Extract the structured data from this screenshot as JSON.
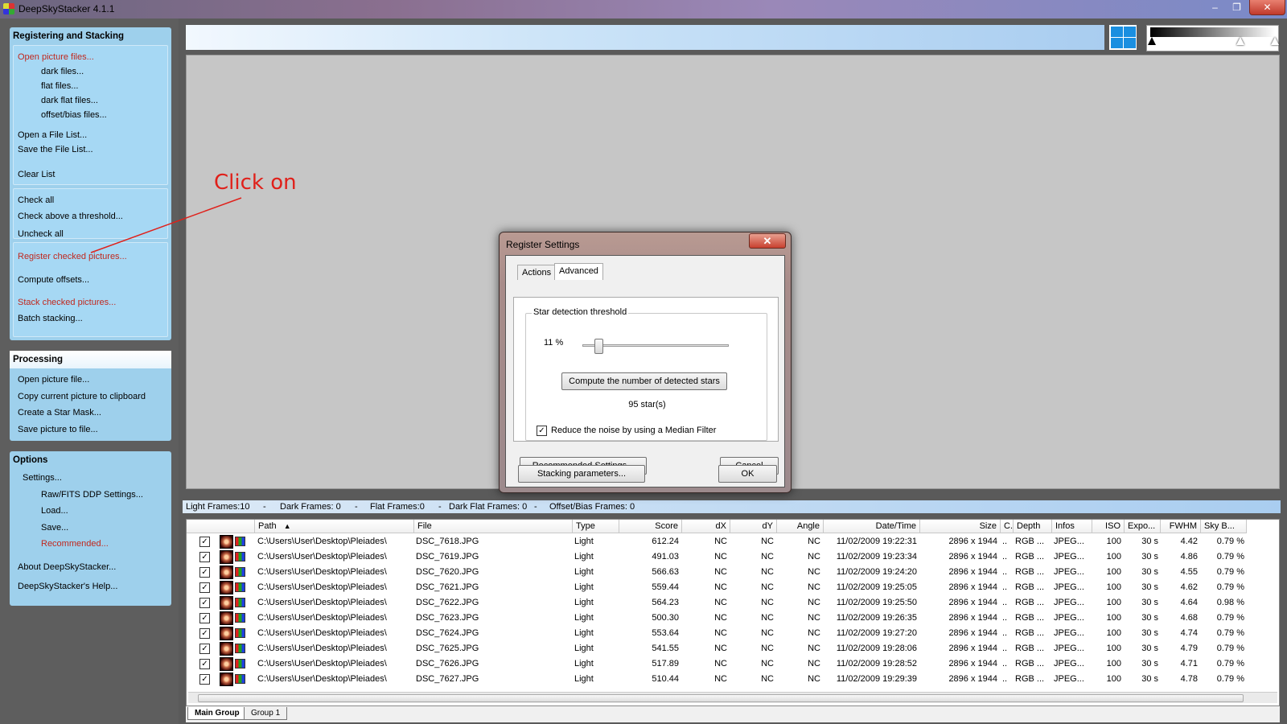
{
  "window": {
    "title": "DeepSkyStacker 4.1.1",
    "minimize": "–",
    "restore": "❐",
    "close": "✕"
  },
  "sidebar": {
    "registering": {
      "title": "Registering and Stacking",
      "open_picture_files": "Open picture files...",
      "dark_files": "dark files...",
      "flat_files": "flat files...",
      "dark_flat_files": "dark flat files...",
      "offset_bias_files": "offset/bias files...",
      "open_file_list": "Open a File List...",
      "save_file_list": "Save the File List...",
      "clear_list": "Clear List",
      "check_all": "Check all",
      "check_above": "Check above a threshold...",
      "uncheck_all": "Uncheck all",
      "register_checked": "Register checked pictures...",
      "compute_offsets": "Compute offsets...",
      "stack_checked": "Stack checked pictures...",
      "batch_stacking": "Batch stacking..."
    },
    "processing": {
      "title": "Processing",
      "open_picture_file": "Open picture file...",
      "copy_clipboard": "Copy current picture to clipboard",
      "create_star_mask": "Create a Star Mask...",
      "save_picture": "Save picture to file..."
    },
    "options": {
      "title": "Options",
      "settings": "Settings...",
      "raw_fits": "Raw/FITS DDP Settings...",
      "load": "Load...",
      "save": "Save...",
      "recommended": "Recommended...",
      "about": "About DeepSkyStacker...",
      "help": "DeepSkyStacker's Help..."
    }
  },
  "annotation": {
    "text": "Click on"
  },
  "frames": {
    "light": "Light Frames:10",
    "sep1": "-",
    "dark": "Dark Frames: 0",
    "sep2": "-",
    "flat": "Flat Frames:0",
    "sep3": "-",
    "dark_flat": "Dark Flat Frames: 0",
    "sep4": "-",
    "offset": "Offset/Bias Frames: 0"
  },
  "table": {
    "columns": [
      "Path",
      "File",
      "Type",
      "Score",
      "dX",
      "dY",
      "Angle",
      "Date/Time",
      "Size",
      "C.",
      "Depth",
      "Infos",
      "ISO",
      "Expo...",
      "FWHM",
      "Sky B..."
    ],
    "sort_indicator": "▲",
    "rows": [
      [
        "C:\\Users\\User\\Desktop\\Pleiades\\",
        "DSC_7618.JPG",
        "Light",
        "612.24",
        "NC",
        "NC",
        "NC",
        "11/02/2009 19:22:31",
        "2896 x 1944",
        "..",
        "RGB ...",
        "JPEG...",
        "100",
        "30 s",
        "4.42",
        "0.79 %"
      ],
      [
        "C:\\Users\\User\\Desktop\\Pleiades\\",
        "DSC_7619.JPG",
        "Light",
        "491.03",
        "NC",
        "NC",
        "NC",
        "11/02/2009 19:23:34",
        "2896 x 1944",
        "..",
        "RGB ...",
        "JPEG...",
        "100",
        "30 s",
        "4.86",
        "0.79 %"
      ],
      [
        "C:\\Users\\User\\Desktop\\Pleiades\\",
        "DSC_7620.JPG",
        "Light",
        "566.63",
        "NC",
        "NC",
        "NC",
        "11/02/2009 19:24:20",
        "2896 x 1944",
        "..",
        "RGB ...",
        "JPEG...",
        "100",
        "30 s",
        "4.55",
        "0.79 %"
      ],
      [
        "C:\\Users\\User\\Desktop\\Pleiades\\",
        "DSC_7621.JPG",
        "Light",
        "559.44",
        "NC",
        "NC",
        "NC",
        "11/02/2009 19:25:05",
        "2896 x 1944",
        "..",
        "RGB ...",
        "JPEG...",
        "100",
        "30 s",
        "4.62",
        "0.79 %"
      ],
      [
        "C:\\Users\\User\\Desktop\\Pleiades\\",
        "DSC_7622.JPG",
        "Light",
        "564.23",
        "NC",
        "NC",
        "NC",
        "11/02/2009 19:25:50",
        "2896 x 1944",
        "..",
        "RGB ...",
        "JPEG...",
        "100",
        "30 s",
        "4.64",
        "0.98 %"
      ],
      [
        "C:\\Users\\User\\Desktop\\Pleiades\\",
        "DSC_7623.JPG",
        "Light",
        "500.30",
        "NC",
        "NC",
        "NC",
        "11/02/2009 19:26:35",
        "2896 x 1944",
        "..",
        "RGB ...",
        "JPEG...",
        "100",
        "30 s",
        "4.68",
        "0.79 %"
      ],
      [
        "C:\\Users\\User\\Desktop\\Pleiades\\",
        "DSC_7624.JPG",
        "Light",
        "553.64",
        "NC",
        "NC",
        "NC",
        "11/02/2009 19:27:20",
        "2896 x 1944",
        "..",
        "RGB ...",
        "JPEG...",
        "100",
        "30 s",
        "4.74",
        "0.79 %"
      ],
      [
        "C:\\Users\\User\\Desktop\\Pleiades\\",
        "DSC_7625.JPG",
        "Light",
        "541.55",
        "NC",
        "NC",
        "NC",
        "11/02/2009 19:28:06",
        "2896 x 1944",
        "..",
        "RGB ...",
        "JPEG...",
        "100",
        "30 s",
        "4.79",
        "0.79 %"
      ],
      [
        "C:\\Users\\User\\Desktop\\Pleiades\\",
        "DSC_7626.JPG",
        "Light",
        "517.89",
        "NC",
        "NC",
        "NC",
        "11/02/2009 19:28:52",
        "2896 x 1944",
        "..",
        "RGB ...",
        "JPEG...",
        "100",
        "30 s",
        "4.71",
        "0.79 %"
      ],
      [
        "C:\\Users\\User\\Desktop\\Pleiades\\",
        "DSC_7627.JPG",
        "Light",
        "510.44",
        "NC",
        "NC",
        "NC",
        "11/02/2009 19:29:39",
        "2896 x 1944",
        "..",
        "RGB ...",
        "JPEG...",
        "100",
        "30 s",
        "4.78",
        "0.79 %"
      ]
    ],
    "checked": [
      true,
      true,
      true,
      true,
      true,
      true,
      true,
      true,
      true,
      true
    ],
    "check_mark": "✓"
  },
  "group_tabs": [
    "Main Group",
    "Group 1"
  ],
  "dialog": {
    "title": "Register Settings",
    "close": "✕",
    "tabs": [
      "Actions",
      "Advanced"
    ],
    "active_tab": "Advanced",
    "threshold_legend": "Star detection threshold",
    "threshold_value": "11 %",
    "threshold_fraction": 0.11,
    "compute_button": "Compute the number of detected stars",
    "star_count": "95 star(s)",
    "median_filter_label": "Reduce the noise by using a Median Filter",
    "median_filter_checked": true,
    "check_mark": "✓",
    "recommended_button": "Recommended Settings...",
    "stacking_button": "Stacking parameters...",
    "cancel_button": "Cancel",
    "ok_button": "OK"
  },
  "colors": {
    "accent_red": "#c0281e",
    "panel_blue": "#9ed0ec",
    "annotation_red": "#e0201a"
  }
}
